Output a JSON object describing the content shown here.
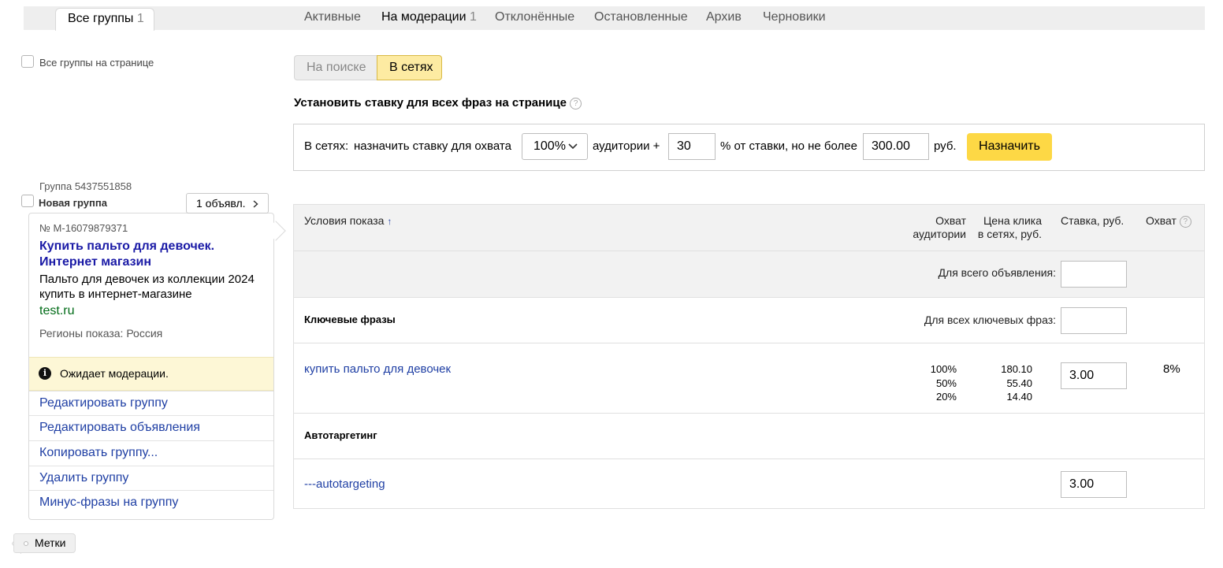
{
  "tabs": {
    "all_groups": {
      "label": "Все группы",
      "count": "1"
    },
    "filters": [
      {
        "label": "Активные",
        "count": ""
      },
      {
        "label": "На модерации",
        "count": "1"
      },
      {
        "label": "Отклонённые",
        "count": ""
      },
      {
        "label": "Остановленные",
        "count": ""
      },
      {
        "label": "Архив",
        "count": ""
      },
      {
        "label": "Черновики",
        "count": ""
      }
    ]
  },
  "select_all_label": "Все группы на странице",
  "placement_toggle": {
    "search": "На поиске",
    "networks": "В сетях",
    "selected": "В сетях"
  },
  "bulk_bid": {
    "heading": "Установить ставку для всех фраз на странице",
    "help_icon": "question-circle-icon",
    "prefix": "В сетях:",
    "text1": "назначить ставку для охвата",
    "coverage_value": "100%",
    "text2": "аудитории +",
    "percent_value": "30",
    "text3": "% от ставки, но не более",
    "max_value": "300.00",
    "currency": "руб.",
    "apply_label": "Назначить"
  },
  "group": {
    "id_label": "Группа 5437551858",
    "name": "Новая группа",
    "ads_button": "1 объявл.",
    "ad": {
      "number": "№ M-16079879371",
      "title": "Купить пальто для девочек. Интернет магазин",
      "text": "Пальто для девочек из коллекции 2024 купить в интернет-магазине",
      "domain": "test.ru",
      "regions": "Регионы показа: Россия"
    },
    "status": "Ожидает модерации.",
    "actions": [
      "Редактировать группу",
      "Редактировать объявления",
      "Копировать группу...",
      "Удалить группу",
      "Минус-фразы на группу"
    ]
  },
  "table": {
    "headers": {
      "conditions": "Условия показа",
      "sort_icon": "sort-arrow-up-icon",
      "reach_line1": "Охват",
      "reach_line2": "аудитории",
      "price_line1": "Цена клика",
      "price_line2": "в сетях, руб.",
      "bid": "Ставка, руб.",
      "coverage": "Охват"
    },
    "for_whole_ad": "Для всего объявления:",
    "for_whole_ad_value": "",
    "keywords_section": "Ключевые фразы",
    "for_all_keywords": "Для всех ключевых фраз:",
    "for_all_keywords_value": "",
    "keyword": {
      "phrase": "купить пальто для девочек",
      "reach": [
        "100%",
        "50%",
        "20%"
      ],
      "prices": [
        "180.10",
        "55.40",
        "14.40"
      ],
      "bid": "3.00",
      "coverage": "8%"
    },
    "autotargeting_section": "Автотаргетинг",
    "autotargeting": {
      "phrase": "---autotargeting",
      "bid": "3.00"
    }
  },
  "tags_button": "Метки"
}
